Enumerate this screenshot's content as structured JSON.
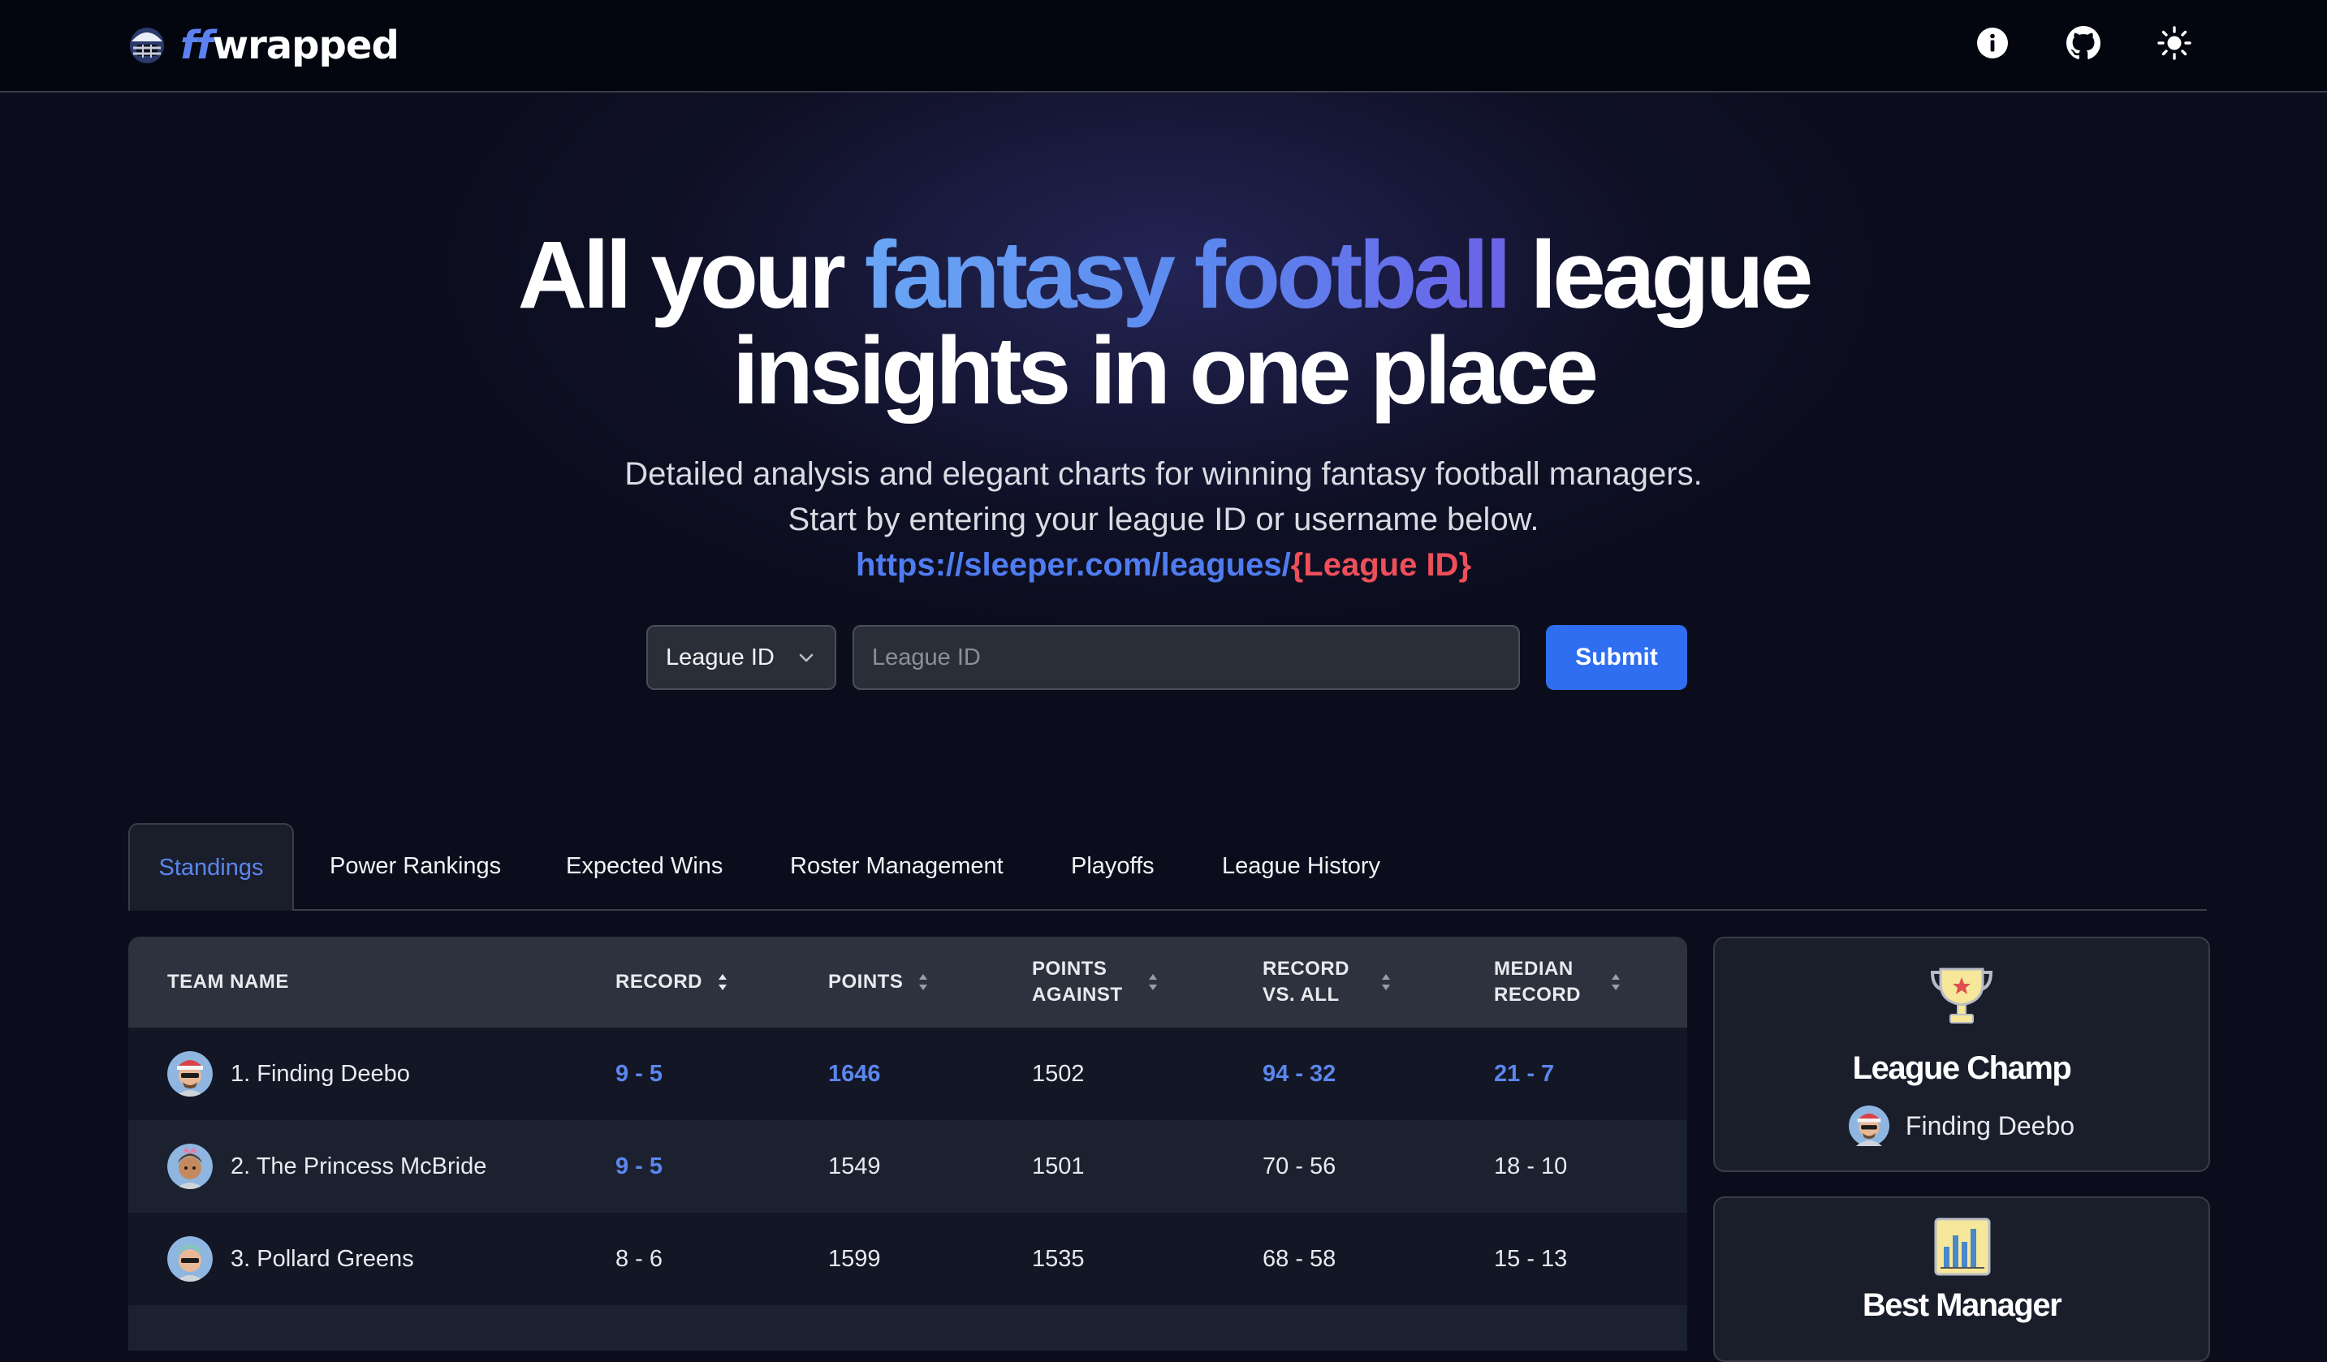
{
  "app": {
    "logo_ff": "ff",
    "logo_rest": "wrapped"
  },
  "nav": {
    "icons": [
      "info-icon",
      "github-icon",
      "sun-icon"
    ]
  },
  "hero": {
    "headline_part1": "All your ",
    "headline_highlight": "fantasy football",
    "headline_part2": " league",
    "headline_line2": "insights in one place",
    "subtext_line1": "Detailed analysis and elegant charts for winning fantasy football managers.",
    "subtext_line2": "Start by entering your league ID or username below.",
    "url_prefix": "https://sleeper.com/leagues/",
    "url_param": "{League ID}"
  },
  "search": {
    "select_value": "League ID",
    "input_placeholder": "League ID",
    "input_value": "",
    "submit_label": "Submit"
  },
  "tabs": [
    {
      "label": "Standings",
      "active": true
    },
    {
      "label": "Power Rankings",
      "active": false
    },
    {
      "label": "Expected Wins",
      "active": false
    },
    {
      "label": "Roster Management",
      "active": false
    },
    {
      "label": "Playoffs",
      "active": false
    },
    {
      "label": "League History",
      "active": false
    }
  ],
  "table": {
    "headers": {
      "team_name": "TEAM NAME",
      "record": "RECORD",
      "points": "POINTS",
      "points_against_1": "POINTS",
      "points_against_2": "AGAINST",
      "record_vs_all_1": "RECORD",
      "record_vs_all_2": "VS. ALL",
      "median_record_1": "MEDIAN",
      "median_record_2": "RECORD"
    },
    "rows": [
      {
        "team": "1. Finding Deebo",
        "record": "9 - 5",
        "points": "1646",
        "points_against": "1502",
        "record_vs_all": "94 - 32",
        "median_record": "21 - 7"
      },
      {
        "team": "2. The Princess McBride",
        "record": "9 - 5",
        "points": "1549",
        "points_against": "1501",
        "record_vs_all": "70 - 56",
        "median_record": "18 - 10"
      },
      {
        "team": "3. Pollard Greens",
        "record": "8 - 6",
        "points": "1599",
        "points_against": "1535",
        "record_vs_all": "68 - 58",
        "median_record": "15 - 13"
      }
    ]
  },
  "cards": {
    "league_champ": {
      "title": "League Champ",
      "team": "Finding Deebo",
      "icon": "trophy-icon"
    },
    "best_manager": {
      "title": "Best Manager",
      "icon": "bar-chart-icon"
    }
  },
  "colors": {
    "accent": "#5b86ee",
    "submit": "#2f6ef0",
    "url_param": "#ef4f5a",
    "background": "#0b0d1c"
  }
}
